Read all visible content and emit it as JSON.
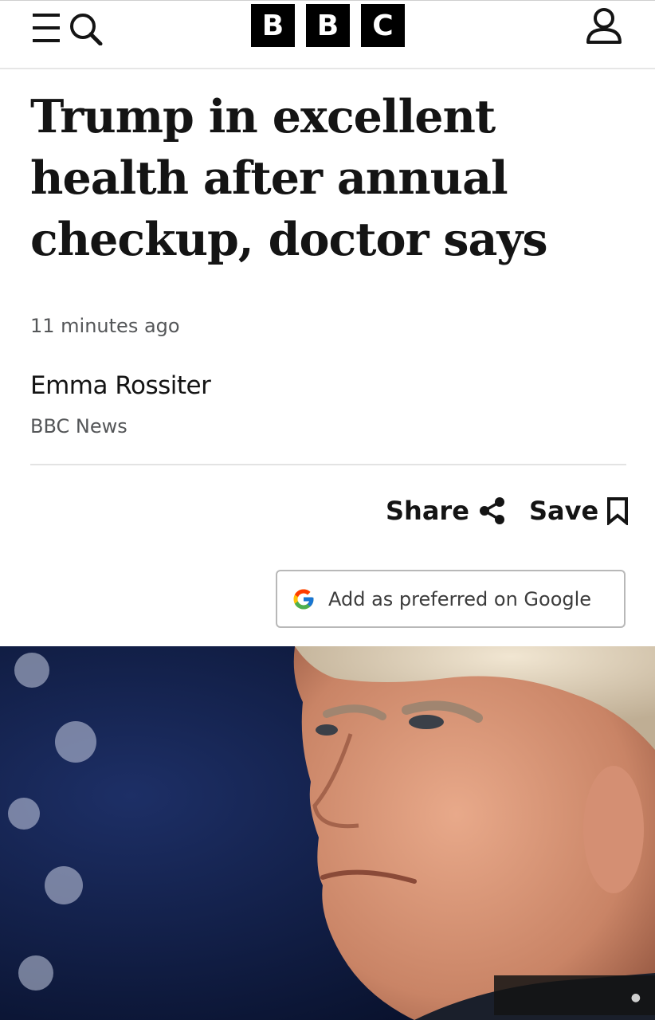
{
  "header": {
    "logo_letters": [
      "B",
      "B",
      "C"
    ],
    "menu_icon": "menu-icon",
    "search_icon": "search-icon",
    "account_icon": "account-icon"
  },
  "article": {
    "headline": "Trump in excellent health after annual checkup, doctor says",
    "timestamp": "11 minutes ago",
    "author": "Emma Rossiter",
    "outlet": "BBC News"
  },
  "actions": {
    "share_label": "Share",
    "share_icon": "share-icon",
    "save_label": "Save",
    "save_icon": "bookmark-icon",
    "google_label": "Add as preferred on Google",
    "google_icon": "google-g-icon"
  },
  "image": {
    "subject": "hero-photo"
  },
  "colors": {
    "text": "#141414",
    "muted": "#545658",
    "logo_bg": "#000000",
    "hero_bg": "#0d1a3c"
  }
}
